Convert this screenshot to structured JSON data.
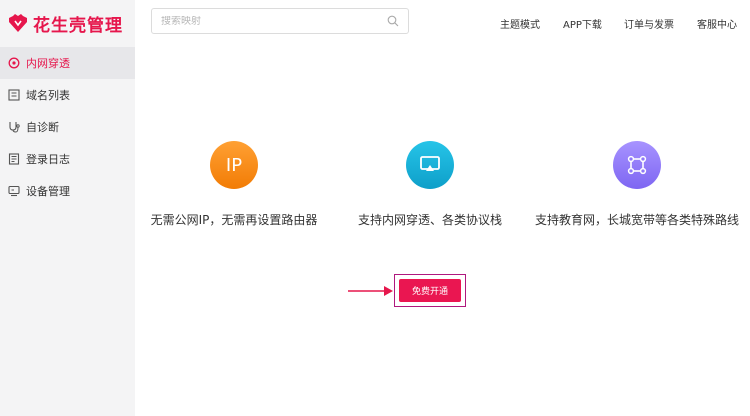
{
  "brand": {
    "name": "花生壳管理",
    "color": "#e6164c"
  },
  "sidebar": {
    "items": [
      {
        "label": "内网穿透",
        "icon": "tunnel-icon",
        "active": true
      },
      {
        "label": "域名列表",
        "icon": "domain-list-icon",
        "active": false
      },
      {
        "label": "自诊断",
        "icon": "diagnosis-icon",
        "active": false
      },
      {
        "label": "登录日志",
        "icon": "log-icon",
        "active": false
      },
      {
        "label": "设备管理",
        "icon": "device-icon",
        "active": false
      }
    ]
  },
  "header": {
    "search": {
      "placeholder": "搜索映射",
      "value": ""
    },
    "nav": [
      "主题模式",
      "APP下载",
      "订单与发票",
      "客服中心"
    ]
  },
  "features": [
    {
      "icon_text": "IP",
      "icon": "ip-icon",
      "color": "#f7890f",
      "text": "无需公网IP，无需再设置路由器"
    },
    {
      "icon": "screen-cast-icon",
      "color": "#1bb3dc",
      "text": "支持内网穿透、各类协议栈"
    },
    {
      "icon": "network-nodes-icon",
      "color": "#8f78f8",
      "text": "支持教育网，长城宽带等各类特殊路线"
    }
  ],
  "cta": {
    "label": "免费开通",
    "color": "#ea1651",
    "annotation_color": "#e6164c"
  }
}
